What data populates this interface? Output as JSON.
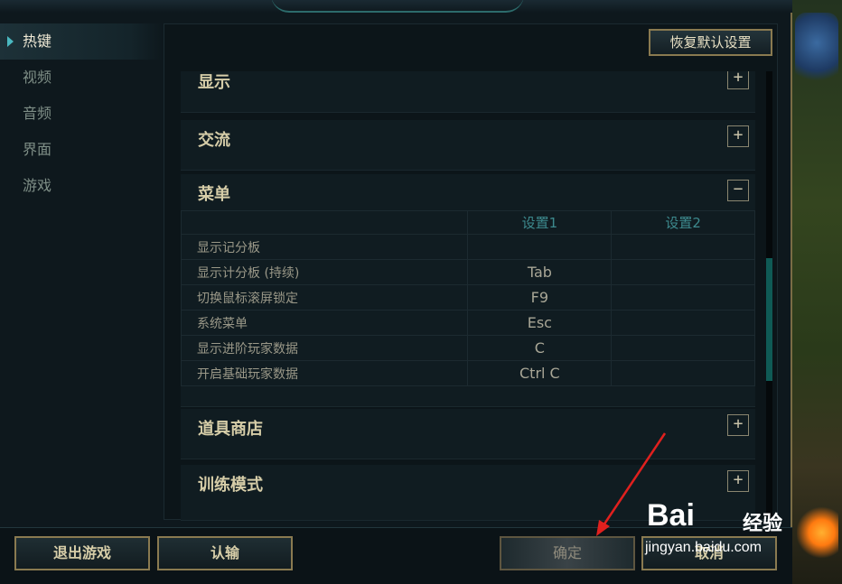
{
  "sidebar": {
    "items": [
      {
        "label": "热键",
        "active": true
      },
      {
        "label": "视频"
      },
      {
        "label": "音频"
      },
      {
        "label": "界面"
      },
      {
        "label": "游戏"
      }
    ]
  },
  "panel": {
    "reset_label": "恢复默认设置",
    "sections": [
      {
        "title": "显示",
        "toggle": "+"
      },
      {
        "title": "交流",
        "toggle": "+"
      },
      {
        "title": "菜单",
        "toggle": "−"
      },
      {
        "title": "道具商店",
        "toggle": "+"
      },
      {
        "title": "训练模式",
        "toggle": "+"
      }
    ],
    "table": {
      "headers": [
        "",
        "设置1",
        "设置2"
      ],
      "rows": [
        {
          "name": "显示记分板",
          "key1": "",
          "key2": ""
        },
        {
          "name": "显示计分板 (持续)",
          "key1": "Tab",
          "key2": ""
        },
        {
          "name": "切换鼠标滚屏锁定",
          "key1": "F9",
          "key2": ""
        },
        {
          "name": "系统菜单",
          "key1": "Esc",
          "key2": ""
        },
        {
          "name": "显示进阶玩家数据",
          "key1": "C",
          "key2": ""
        },
        {
          "name": "开启基础玩家数据",
          "key1": "Ctrl  C",
          "key2": ""
        }
      ]
    },
    "scroll_position": 0.58
  },
  "footer": {
    "quit_label": "退出游戏",
    "surrender_label": "认输",
    "confirm_label": "确定",
    "cancel_label": "取消"
  },
  "watermark": {
    "brand": "Bai",
    "brand_cn": "经验",
    "url": "jingyan.baidu.com"
  },
  "colors": {
    "accent_teal": "#3d8a8e",
    "border_gold": "#8a7a50",
    "annotation_red": "#e0201e"
  }
}
